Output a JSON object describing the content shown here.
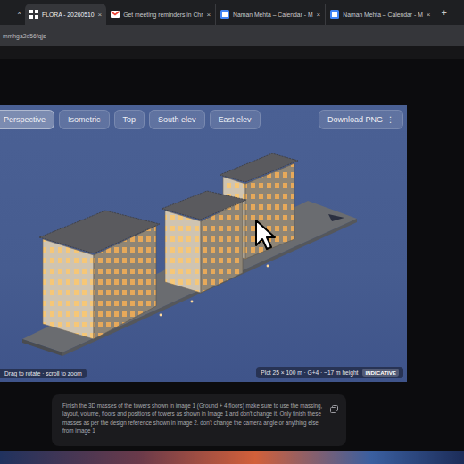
{
  "browser": {
    "partial_tab_close": "×",
    "tabs": [
      {
        "label": "FLORA - 20260510",
        "close": "×",
        "selected": true,
        "kind": "flora"
      },
      {
        "label": "Get meeting reminders in Chr",
        "close": "×",
        "selected": false,
        "kind": "gmail"
      },
      {
        "label": "Naman Mehta – Calendar - M",
        "close": "×",
        "selected": false,
        "kind": "calendar"
      },
      {
        "label": "Naman Mehta – Calendar - M",
        "close": "×",
        "selected": false,
        "kind": "calendar"
      }
    ],
    "new_tab": "+",
    "address": "mmhga2d56fqjs"
  },
  "viewer": {
    "views": [
      {
        "label": "Perspective",
        "selected": true
      },
      {
        "label": "Isometric",
        "selected": false
      },
      {
        "label": "Top",
        "selected": false
      },
      {
        "label": "South elev",
        "selected": false
      },
      {
        "label": "East elev",
        "selected": false
      }
    ],
    "download": "Download PNG",
    "menu": "⋮",
    "hint": "Drag to rotate · scroll to zoom",
    "info": "Plot 25 × 100 m · G+4 · ~17 m height",
    "badge": "INDICATIVE"
  },
  "prompt": {
    "text": "Finish the 3D masses of the towers shown in image 1 (Ground + 4 floors) make sure to use the massing, layout, volume, floors and positions of towers as shown in Image 1 and don't change it. Only finish these masses as per the design reference shown in image 2. don't change the camera angle or anything else from image 1"
  }
}
